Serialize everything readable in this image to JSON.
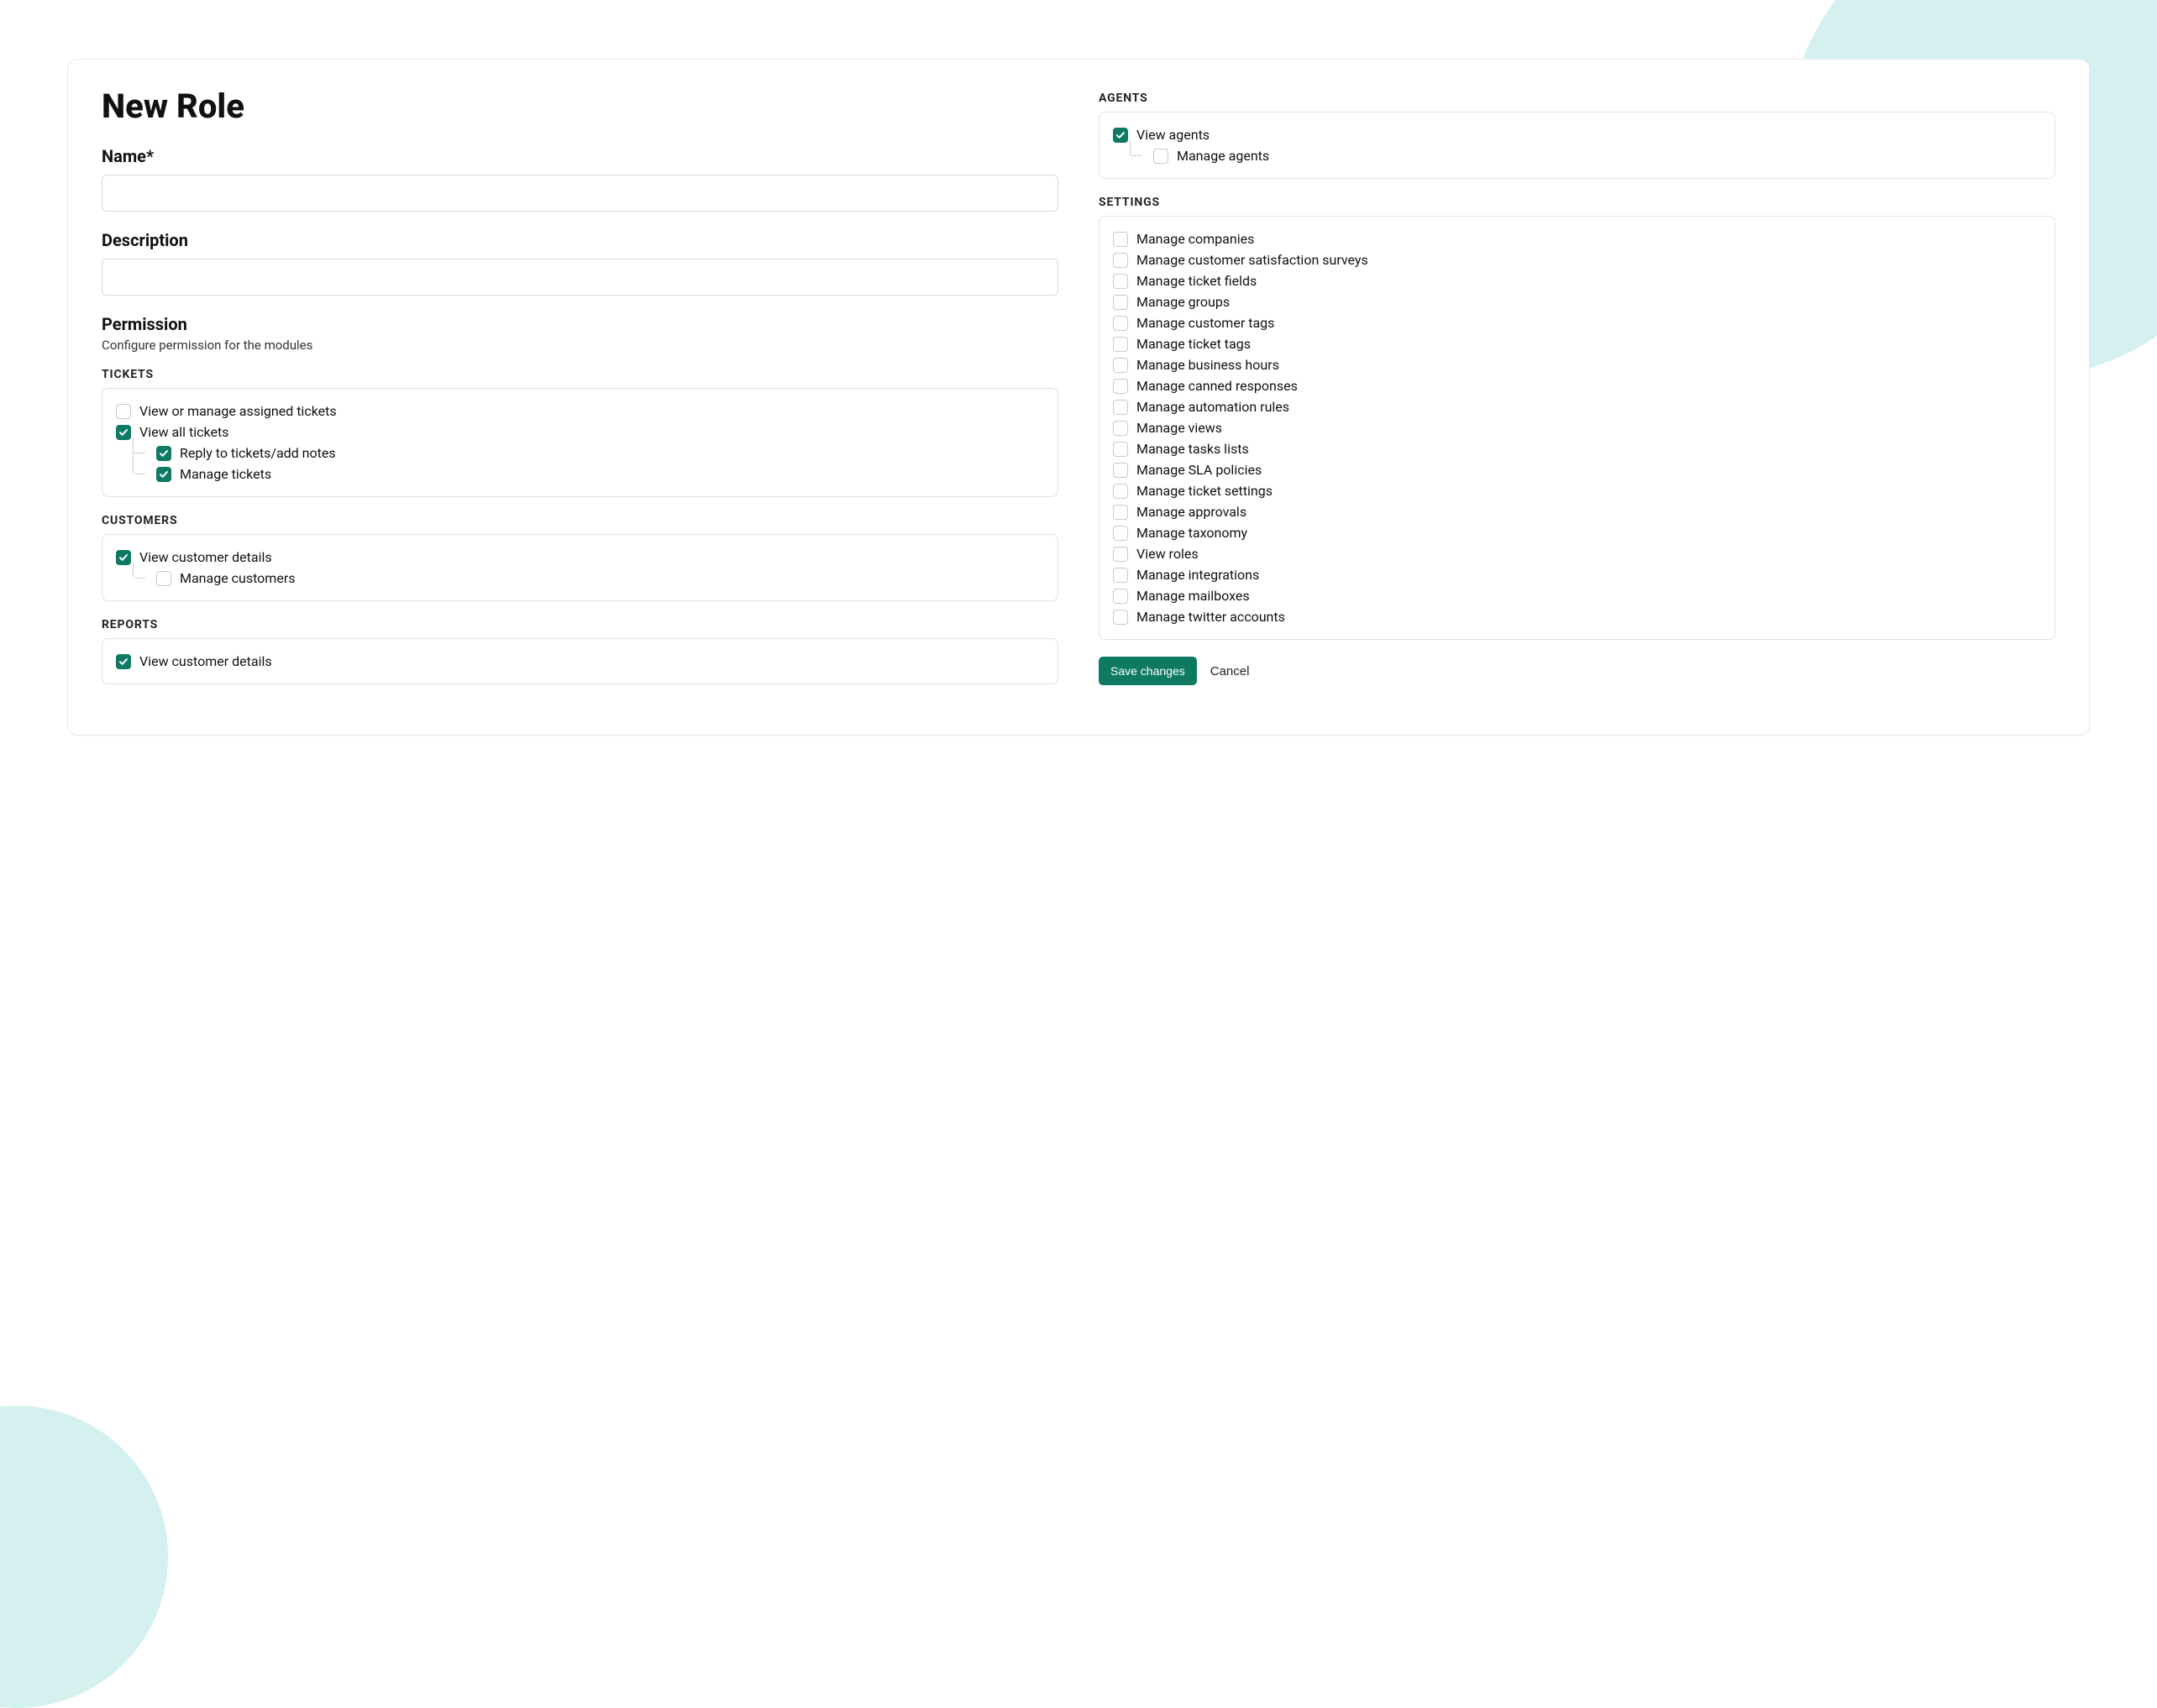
{
  "page": {
    "title": "New Role",
    "name_label": "Name*",
    "name_value": "",
    "description_label": "Description",
    "description_value": "",
    "permission_title": "Permission",
    "permission_subtitle": "Configure permission for the modules"
  },
  "groups": {
    "tickets": {
      "heading": "TICKETS",
      "items": [
        {
          "label": "View or manage assigned tickets",
          "checked": false
        },
        {
          "label": "View all tickets",
          "checked": true
        },
        {
          "label": "Reply to tickets/add notes",
          "checked": true,
          "nested": true
        },
        {
          "label": "Manage tickets",
          "checked": true,
          "nested": true
        }
      ]
    },
    "customers": {
      "heading": "CUSTOMERS",
      "items": [
        {
          "label": "View customer details",
          "checked": true
        },
        {
          "label": "Manage customers",
          "checked": false,
          "nested": true
        }
      ]
    },
    "reports": {
      "heading": "REPORTS",
      "items": [
        {
          "label": "View customer details",
          "checked": true
        }
      ]
    },
    "agents": {
      "heading": "AGENTS",
      "items": [
        {
          "label": "View agents",
          "checked": true
        },
        {
          "label": "Manage agents",
          "checked": false,
          "nested": true
        }
      ]
    },
    "settings": {
      "heading": "SETTINGS",
      "items": [
        {
          "label": "Manage companies",
          "checked": false
        },
        {
          "label": "Manage customer satisfaction surveys",
          "checked": false
        },
        {
          "label": "Manage ticket fields",
          "checked": false
        },
        {
          "label": "Manage groups",
          "checked": false
        },
        {
          "label": "Manage customer tags",
          "checked": false
        },
        {
          "label": "Manage ticket tags",
          "checked": false
        },
        {
          "label": "Manage business hours",
          "checked": false
        },
        {
          "label": "Manage canned responses",
          "checked": false
        },
        {
          "label": "Manage automation rules",
          "checked": false
        },
        {
          "label": "Manage views",
          "checked": false
        },
        {
          "label": "Manage tasks lists",
          "checked": false
        },
        {
          "label": "Manage SLA policies",
          "checked": false
        },
        {
          "label": "Manage ticket settings",
          "checked": false
        },
        {
          "label": "Manage approvals",
          "checked": false
        },
        {
          "label": "Manage taxonomy",
          "checked": false
        },
        {
          "label": "View roles",
          "checked": false
        },
        {
          "label": "Manage integrations",
          "checked": false
        },
        {
          "label": "Manage mailboxes",
          "checked": false
        },
        {
          "label": "Manage twitter accounts",
          "checked": false
        }
      ]
    }
  },
  "actions": {
    "save": "Save changes",
    "cancel": "Cancel"
  },
  "colors": {
    "accent": "#0f7a63",
    "bg_tint": "#d4f0ef"
  }
}
